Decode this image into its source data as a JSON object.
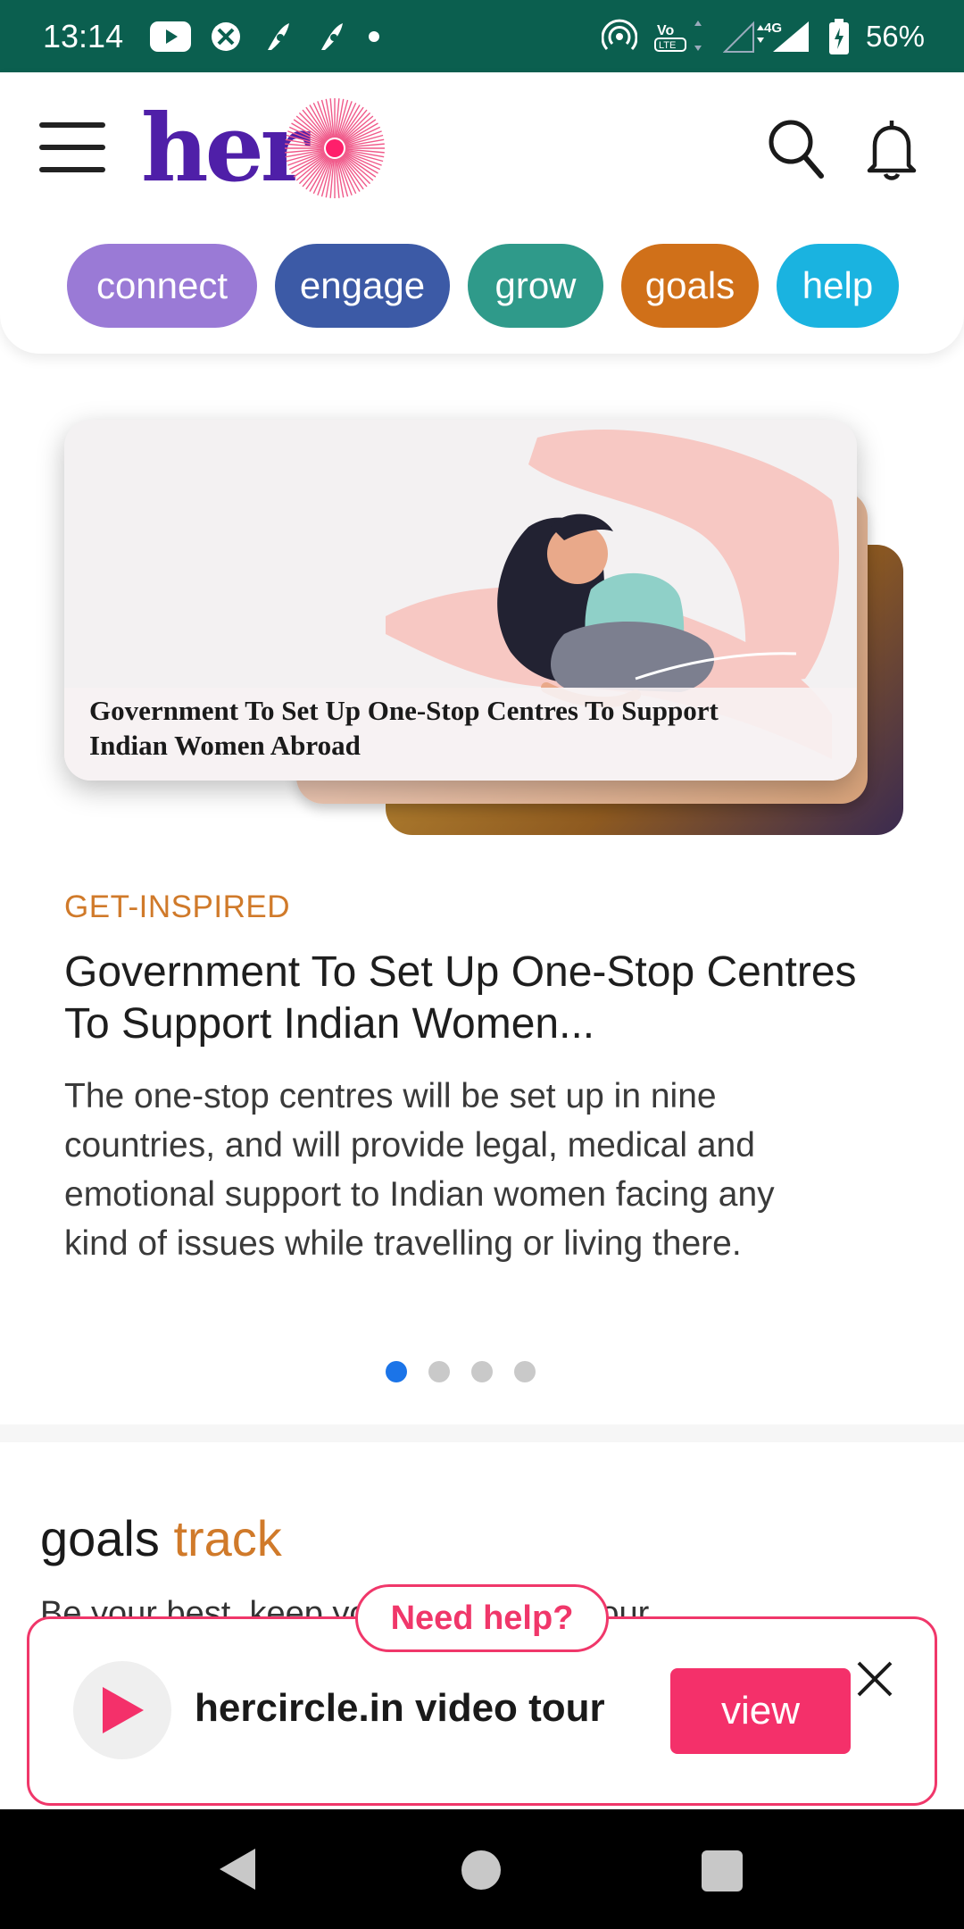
{
  "status_bar": {
    "time": "13:14",
    "network": "4G",
    "volte": "Vo LTE",
    "battery": "56%",
    "icons": [
      "youtube-icon",
      "pinwheel-icon",
      "app-icon",
      "app-icon",
      "dot-icon",
      "hotspot-icon",
      "volte-icon",
      "signal-icon",
      "battery-icon"
    ]
  },
  "header": {
    "logo_text": "her",
    "chips": [
      {
        "label": "connect",
        "color": "#9a7ad6"
      },
      {
        "label": "engage",
        "color": "#3c5aa6"
      },
      {
        "label": "grow",
        "color": "#2f9a8a"
      },
      {
        "label": "goals",
        "color": "#d07019"
      },
      {
        "label": "help",
        "color": "#1ab3e0"
      }
    ]
  },
  "carousel": {
    "image_caption": "Government To Set Up One-Stop Centres To Support Indian Women Abroad",
    "category": "GET-INSPIRED",
    "title": "Government To Set Up One-Stop Centres To Support Indian Women...",
    "description": "The one-stop centres will be set up in nine countries, and will provide legal, medical and emotional support to Indian women facing any kind of issues while travelling or living there.",
    "slide_count": 4,
    "active_slide": 1
  },
  "goals": {
    "heading_1": "goals",
    "heading_2": "track",
    "subtext": "Be your best, keep your health using our"
  },
  "help_popup": {
    "pill": "Need help?",
    "text": "hercircle.in video tour",
    "button": "view",
    "accent": "#f0376a"
  }
}
